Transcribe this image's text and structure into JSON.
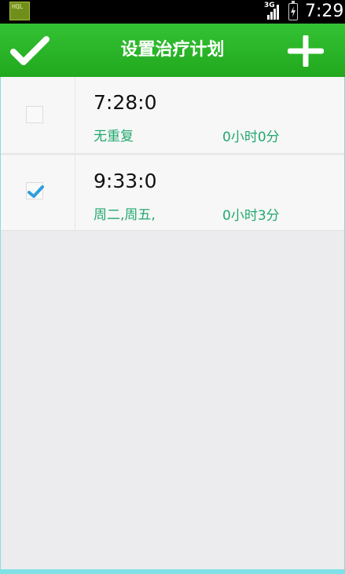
{
  "status_bar": {
    "app_badge": "HQL",
    "network": "3G",
    "time": "7:29"
  },
  "action_bar": {
    "title": "设置治疗计划",
    "confirm_icon": "check-icon",
    "add_icon": "plus-icon"
  },
  "plans": [
    {
      "time": "7:28:0",
      "repeat": "无重复",
      "duration": "0小时0分",
      "checked": false
    },
    {
      "time": "9:33:0",
      "repeat": "周二,周五,",
      "duration": "0小时3分",
      "checked": true
    }
  ],
  "colors": {
    "header_green": "#2bb62a",
    "accent_text": "#22a86e",
    "check_blue": "#2e9fdc"
  }
}
